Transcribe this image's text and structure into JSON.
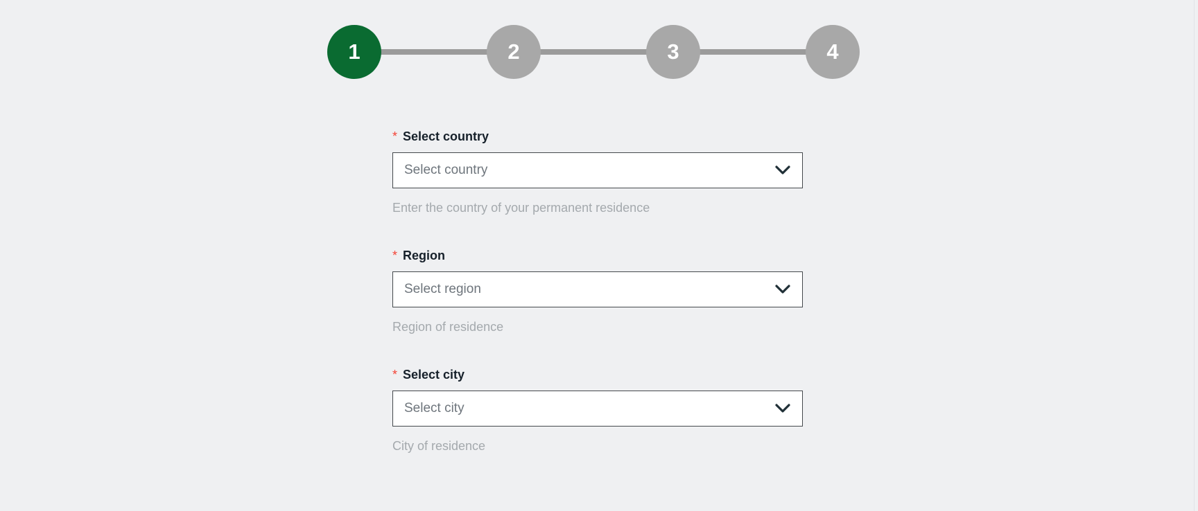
{
  "colors": {
    "page_background": "#eff0f2",
    "step_active": "#0a6b31",
    "step_inactive": "#a8a8a8",
    "step_connector": "#9b9b9b",
    "required_star": "#f44336",
    "field_border": "#44484c",
    "field_background": "#ffffff",
    "placeholder_text": "#6e757c",
    "hint_text": "#a4a9ad",
    "label_text": "#16202a",
    "chevron": "#203037"
  },
  "stepper": {
    "current_step": 1,
    "total_steps": 4,
    "steps": [
      {
        "number": "1",
        "state": "active"
      },
      {
        "number": "2",
        "state": "inactive"
      },
      {
        "number": "3",
        "state": "inactive"
      },
      {
        "number": "4",
        "state": "inactive"
      }
    ]
  },
  "form": {
    "fields": [
      {
        "label": "Select country",
        "required_marker": "*",
        "value": "Select country",
        "placeholder": "Select country",
        "hint": "Enter the country of your permanent residence",
        "icon": "chevron-down-icon"
      },
      {
        "label": "Region",
        "required_marker": "*",
        "value": "Select region",
        "placeholder": "Select region",
        "hint": "Region of residence",
        "icon": "chevron-down-icon"
      },
      {
        "label": "Select city",
        "required_marker": "*",
        "value": "Select city",
        "placeholder": "Select city",
        "hint": "City of residence",
        "icon": "chevron-down-icon"
      }
    ]
  }
}
